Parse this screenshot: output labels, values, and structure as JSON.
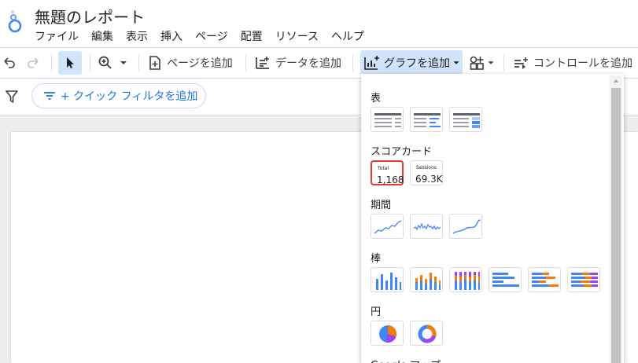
{
  "app": {
    "title": "無題のレポート"
  },
  "menu": [
    "ファイル",
    "編集",
    "表示",
    "挿入",
    "ページ",
    "配置",
    "リソース",
    "ヘルプ"
  ],
  "toolbar": {
    "add_page": "ページを追加",
    "add_data": "データを追加",
    "add_chart": "グラフを追加",
    "add_control": "コントロールを追加"
  },
  "filter": {
    "quick_filter": "+ クイック フィルタを追加"
  },
  "dropdown": {
    "sections": {
      "table": "表",
      "scorecard": "スコアカード",
      "timeseries": "期間",
      "bar": "棒",
      "pie": "円",
      "geo": "Google マップ"
    },
    "scorecards": [
      {
        "label": "Total",
        "value": "1,168"
      },
      {
        "label": "Sessions",
        "value": "69.3K"
      }
    ]
  },
  "colors": {
    "accent_blue": "#1a73e8",
    "chart_blue": "#4285f4",
    "chart_orange": "#f57c00",
    "chart_purple": "#a142f4",
    "highlight_red": "#e53935"
  }
}
